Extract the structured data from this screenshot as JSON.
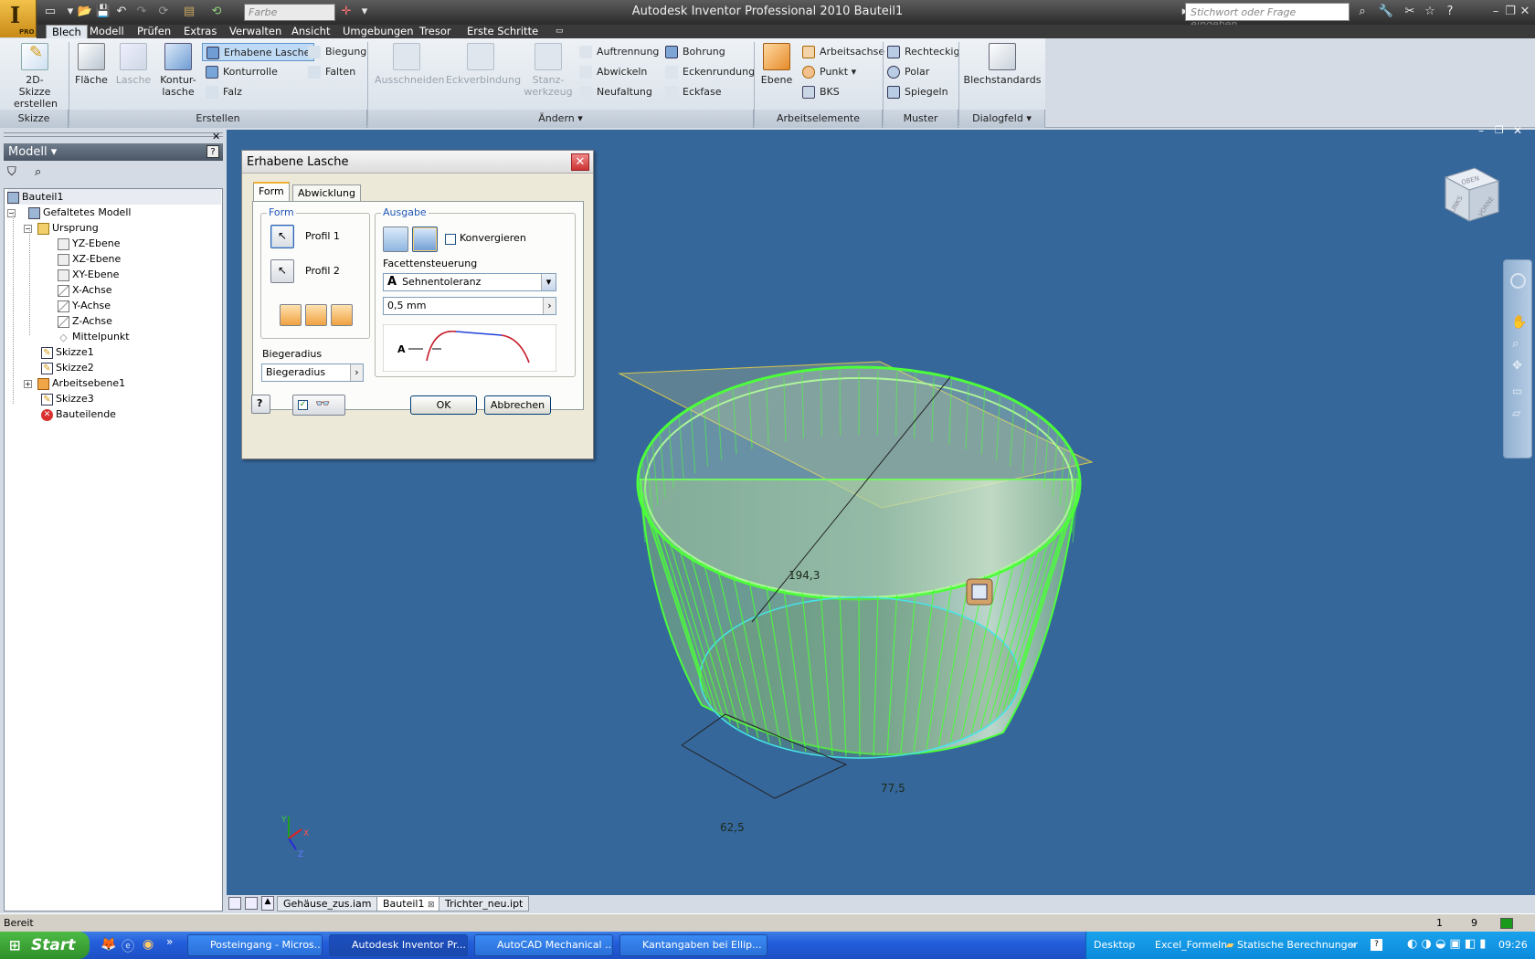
{
  "app": {
    "title": "Autodesk Inventor Professional 2010    Bauteil1",
    "logo_letter": "I",
    "logo_badge": "PRO",
    "color_combo": "Farbe",
    "help_placeholder": "Stichwort oder Frage eingeben"
  },
  "menu": [
    "Blech",
    "Modell",
    "Prüfen",
    "Extras",
    "Verwalten",
    "Ansicht",
    "Umgebungen",
    "Tresor",
    "Erste Schritte"
  ],
  "ribbon": {
    "skizze": {
      "big": "2D-Skizze erstellen",
      "title": "Skizze"
    },
    "erstellen": {
      "flaeche": "Fläche",
      "lasche": "Lasche",
      "konturlasche": "Kontur-\nlasche",
      "erhabene": "Erhabene Lasche",
      "konturrolle": "Konturrolle",
      "falz": "Falz",
      "biegung": "Biegung",
      "falten": "Falten",
      "title": "Erstellen"
    },
    "aendern": {
      "ausschneiden": "Ausschneiden",
      "eckverbindung": "Eckverbindung",
      "stanz": "Stanz-\nwerkzeug",
      "auftrennung": "Auftrennung",
      "abwickeln": "Abwickeln",
      "neufaltung": "Neufaltung",
      "bohrung": "Bohrung",
      "eckenrundung": "Eckenrundung",
      "eckfase": "Eckfase",
      "title": "Ändern"
    },
    "arbeitselemente": {
      "ebene": "Ebene",
      "achse": "Arbeitsachse",
      "punkt": "Punkt",
      "bks": "BKS",
      "title": "Arbeitselemente"
    },
    "muster": {
      "rechteckig": "Rechteckig",
      "polar": "Polar",
      "spiegeln": "Spiegeln",
      "title": "Muster"
    },
    "dialogfeld": {
      "blechstandards": "Blechstandards",
      "title": "Dialogfeld"
    }
  },
  "browser": {
    "title": "Modell",
    "tree": [
      "Bauteil1",
      "Gefaltetes Modell",
      "Ursprung",
      "YZ-Ebene",
      "XZ-Ebene",
      "XY-Ebene",
      "X-Achse",
      "Y-Achse",
      "Z-Achse",
      "Mittelpunkt",
      "Skizze1",
      "Skizze2",
      "Arbeitsebene1",
      "Skizze3",
      "Bauteilende"
    ]
  },
  "dialog": {
    "title": "Erhabene Lasche",
    "tabs": [
      "Form",
      "Abwicklung"
    ],
    "form_group": "Form",
    "profil1": "Profil 1",
    "profil2": "Profil 2",
    "ausgabe_group": "Ausgabe",
    "konvergieren": "Konvergieren",
    "facetten_label": "Facettensteuerung",
    "facetten_value": "Sehnentoleranz",
    "facetten_amount": "0,5 mm",
    "biegeradius_label": "Biegeradius",
    "biegeradius_value": "Biegeradius",
    "ok": "OK",
    "cancel": "Abbrechen"
  },
  "viewport": {
    "dim_diameter": "194,3",
    "dim_width": "62,5",
    "dim_depth": "77,5",
    "viewcube_top": "OBEN",
    "viewcube_left": "LINKS",
    "viewcube_front": "VORNE",
    "triad": [
      "Y",
      "X",
      "Z"
    ]
  },
  "doc_tabs": [
    "Gehäuse_zus.iam",
    "Bauteil1",
    "Trichter_neu.ipt"
  ],
  "status": {
    "text": "Bereit",
    "num1": "1",
    "num2": "9"
  },
  "taskbar": {
    "start": "Start",
    "tasks": [
      "Posteingang - Micros...",
      "Autodesk Inventor Pr...",
      "AutoCAD Mechanical ...",
      "Kantangaben bei Ellip..."
    ],
    "tray_desktop": "Desktop",
    "tray_excel": "Excel_Formeln",
    "tray_folder": "Statische Berechnunger",
    "time": "09:26"
  },
  "colors": {
    "viewport": "#36679b",
    "accent": "#2158b8",
    "mesh": "#4cff3a"
  }
}
